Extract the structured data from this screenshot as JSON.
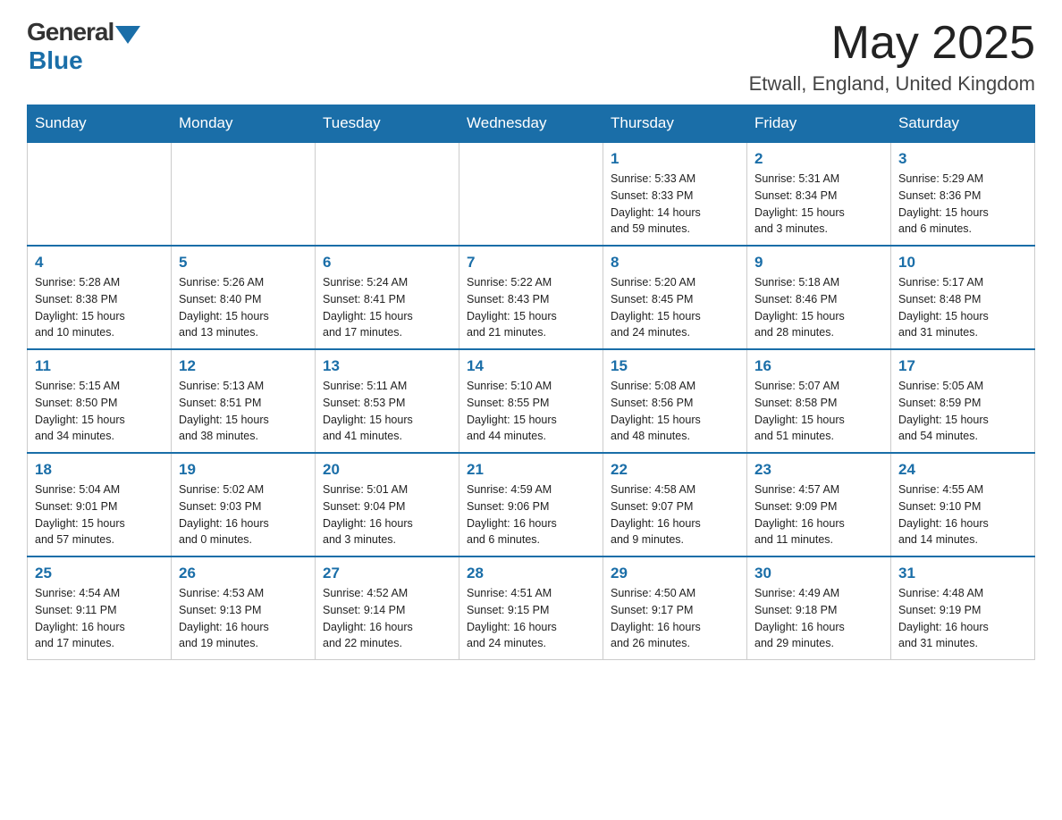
{
  "header": {
    "logo_general": "General",
    "logo_blue": "Blue",
    "month_title": "May 2025",
    "location": "Etwall, England, United Kingdom"
  },
  "days_of_week": [
    "Sunday",
    "Monday",
    "Tuesday",
    "Wednesday",
    "Thursday",
    "Friday",
    "Saturday"
  ],
  "weeks": [
    [
      {
        "day": "",
        "info": ""
      },
      {
        "day": "",
        "info": ""
      },
      {
        "day": "",
        "info": ""
      },
      {
        "day": "",
        "info": ""
      },
      {
        "day": "1",
        "info": "Sunrise: 5:33 AM\nSunset: 8:33 PM\nDaylight: 14 hours\nand 59 minutes."
      },
      {
        "day": "2",
        "info": "Sunrise: 5:31 AM\nSunset: 8:34 PM\nDaylight: 15 hours\nand 3 minutes."
      },
      {
        "day": "3",
        "info": "Sunrise: 5:29 AM\nSunset: 8:36 PM\nDaylight: 15 hours\nand 6 minutes."
      }
    ],
    [
      {
        "day": "4",
        "info": "Sunrise: 5:28 AM\nSunset: 8:38 PM\nDaylight: 15 hours\nand 10 minutes."
      },
      {
        "day": "5",
        "info": "Sunrise: 5:26 AM\nSunset: 8:40 PM\nDaylight: 15 hours\nand 13 minutes."
      },
      {
        "day": "6",
        "info": "Sunrise: 5:24 AM\nSunset: 8:41 PM\nDaylight: 15 hours\nand 17 minutes."
      },
      {
        "day": "7",
        "info": "Sunrise: 5:22 AM\nSunset: 8:43 PM\nDaylight: 15 hours\nand 21 minutes."
      },
      {
        "day": "8",
        "info": "Sunrise: 5:20 AM\nSunset: 8:45 PM\nDaylight: 15 hours\nand 24 minutes."
      },
      {
        "day": "9",
        "info": "Sunrise: 5:18 AM\nSunset: 8:46 PM\nDaylight: 15 hours\nand 28 minutes."
      },
      {
        "day": "10",
        "info": "Sunrise: 5:17 AM\nSunset: 8:48 PM\nDaylight: 15 hours\nand 31 minutes."
      }
    ],
    [
      {
        "day": "11",
        "info": "Sunrise: 5:15 AM\nSunset: 8:50 PM\nDaylight: 15 hours\nand 34 minutes."
      },
      {
        "day": "12",
        "info": "Sunrise: 5:13 AM\nSunset: 8:51 PM\nDaylight: 15 hours\nand 38 minutes."
      },
      {
        "day": "13",
        "info": "Sunrise: 5:11 AM\nSunset: 8:53 PM\nDaylight: 15 hours\nand 41 minutes."
      },
      {
        "day": "14",
        "info": "Sunrise: 5:10 AM\nSunset: 8:55 PM\nDaylight: 15 hours\nand 44 minutes."
      },
      {
        "day": "15",
        "info": "Sunrise: 5:08 AM\nSunset: 8:56 PM\nDaylight: 15 hours\nand 48 minutes."
      },
      {
        "day": "16",
        "info": "Sunrise: 5:07 AM\nSunset: 8:58 PM\nDaylight: 15 hours\nand 51 minutes."
      },
      {
        "day": "17",
        "info": "Sunrise: 5:05 AM\nSunset: 8:59 PM\nDaylight: 15 hours\nand 54 minutes."
      }
    ],
    [
      {
        "day": "18",
        "info": "Sunrise: 5:04 AM\nSunset: 9:01 PM\nDaylight: 15 hours\nand 57 minutes."
      },
      {
        "day": "19",
        "info": "Sunrise: 5:02 AM\nSunset: 9:03 PM\nDaylight: 16 hours\nand 0 minutes."
      },
      {
        "day": "20",
        "info": "Sunrise: 5:01 AM\nSunset: 9:04 PM\nDaylight: 16 hours\nand 3 minutes."
      },
      {
        "day": "21",
        "info": "Sunrise: 4:59 AM\nSunset: 9:06 PM\nDaylight: 16 hours\nand 6 minutes."
      },
      {
        "day": "22",
        "info": "Sunrise: 4:58 AM\nSunset: 9:07 PM\nDaylight: 16 hours\nand 9 minutes."
      },
      {
        "day": "23",
        "info": "Sunrise: 4:57 AM\nSunset: 9:09 PM\nDaylight: 16 hours\nand 11 minutes."
      },
      {
        "day": "24",
        "info": "Sunrise: 4:55 AM\nSunset: 9:10 PM\nDaylight: 16 hours\nand 14 minutes."
      }
    ],
    [
      {
        "day": "25",
        "info": "Sunrise: 4:54 AM\nSunset: 9:11 PM\nDaylight: 16 hours\nand 17 minutes."
      },
      {
        "day": "26",
        "info": "Sunrise: 4:53 AM\nSunset: 9:13 PM\nDaylight: 16 hours\nand 19 minutes."
      },
      {
        "day": "27",
        "info": "Sunrise: 4:52 AM\nSunset: 9:14 PM\nDaylight: 16 hours\nand 22 minutes."
      },
      {
        "day": "28",
        "info": "Sunrise: 4:51 AM\nSunset: 9:15 PM\nDaylight: 16 hours\nand 24 minutes."
      },
      {
        "day": "29",
        "info": "Sunrise: 4:50 AM\nSunset: 9:17 PM\nDaylight: 16 hours\nand 26 minutes."
      },
      {
        "day": "30",
        "info": "Sunrise: 4:49 AM\nSunset: 9:18 PM\nDaylight: 16 hours\nand 29 minutes."
      },
      {
        "day": "31",
        "info": "Sunrise: 4:48 AM\nSunset: 9:19 PM\nDaylight: 16 hours\nand 31 minutes."
      }
    ]
  ]
}
